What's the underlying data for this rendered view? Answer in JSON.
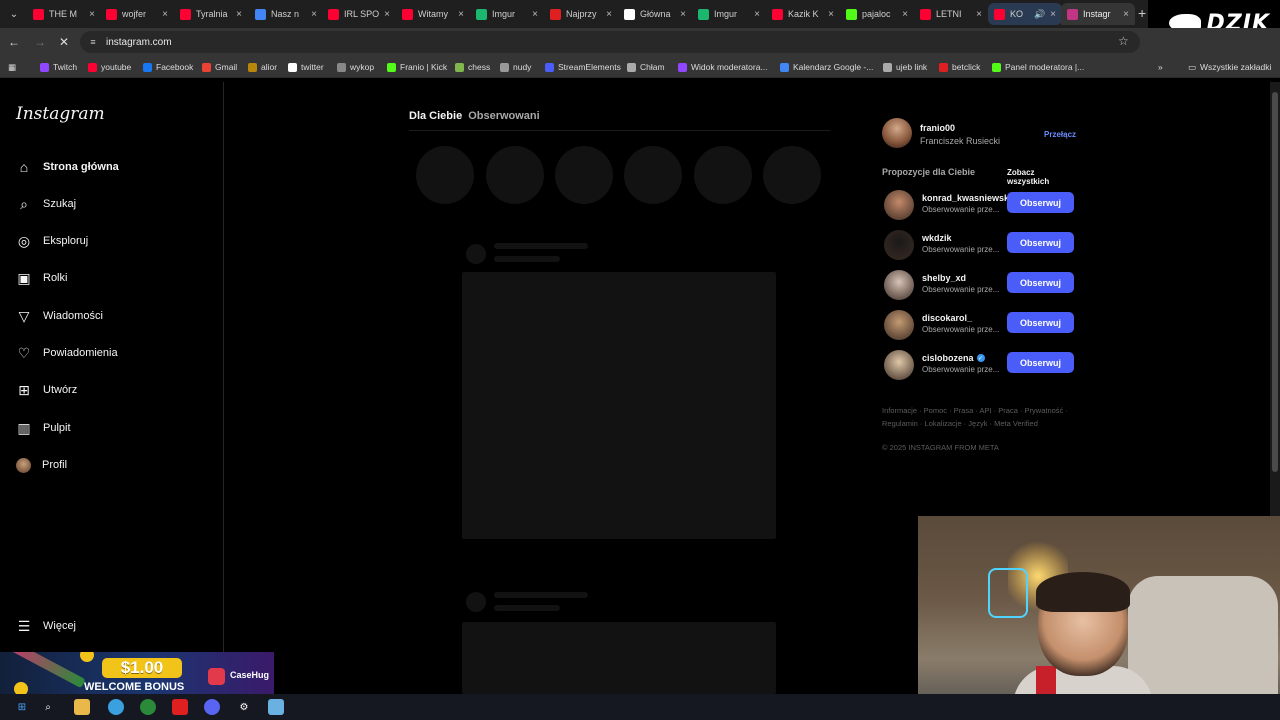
{
  "browser": {
    "tabs": [
      {
        "title": "THE M",
        "favicon_color": "#ff0033",
        "active": false
      },
      {
        "title": "wojfer",
        "favicon_color": "#ff0033",
        "active": false
      },
      {
        "title": "Tyralnia",
        "favicon_color": "#ff0033",
        "active": false
      },
      {
        "title": "Nasz n",
        "favicon_color": "#4285f4",
        "active": false
      },
      {
        "title": "IRL SPO",
        "favicon_color": "#ff0033",
        "active": false
      },
      {
        "title": "Witamy",
        "favicon_color": "#ff0033",
        "active": false
      },
      {
        "title": "Imgur",
        "favicon_color": "#1bb76e",
        "active": false
      },
      {
        "title": "Najprzy",
        "favicon_color": "#e02020",
        "active": false
      },
      {
        "title": "Główna",
        "favicon_color": "#ffffff",
        "active": false
      },
      {
        "title": "Imgur",
        "favicon_color": "#1bb76e",
        "active": false
      },
      {
        "title": "Kazik K",
        "favicon_color": "#ff0033",
        "active": false
      },
      {
        "title": "pajaloc",
        "favicon_color": "#53fc18",
        "active": false
      },
      {
        "title": "LETNI",
        "favicon_color": "#ff0033",
        "active": false
      },
      {
        "title": "KO",
        "favicon_color": "#ff0033",
        "active": false,
        "playing": true
      },
      {
        "title": "Instagr",
        "favicon_color": "#c13584",
        "active": true
      }
    ],
    "new_tab_label": "+",
    "url": "instagram.com",
    "bookmarks": [
      {
        "label": "Twitch",
        "color": "#9146ff"
      },
      {
        "label": "youtube",
        "color": "#ff0033"
      },
      {
        "label": "Facebook",
        "color": "#1877f2"
      },
      {
        "label": "Gmail",
        "color": "#ea4335"
      },
      {
        "label": "alior",
        "color": "#b8860b"
      },
      {
        "label": "twitter",
        "color": "#ffffff"
      },
      {
        "label": "wykop",
        "color": "#888888"
      },
      {
        "label": "Franio | Kick",
        "color": "#53fc18"
      },
      {
        "label": "chess",
        "color": "#81b64c"
      },
      {
        "label": "nudy",
        "color": "#999999"
      },
      {
        "label": "StreamElements",
        "color": "#4a5df9"
      },
      {
        "label": "Chłam",
        "color": "#aaaaaa"
      },
      {
        "label": "Widok moderatora...",
        "color": "#9146ff"
      },
      {
        "label": "Kalendarz Google -...",
        "color": "#4285f4"
      },
      {
        "label": "ujeb link",
        "color": "#aaaaaa"
      },
      {
        "label": "betclick",
        "color": "#e02020"
      },
      {
        "label": "Panel moderatora |...",
        "color": "#53fc18"
      }
    ],
    "more_bookmarks": "»",
    "all_bookmarks": "Wszystkie zakładki"
  },
  "stream_logo": "DZIK",
  "instagram": {
    "logo": "Instagram",
    "nav": [
      {
        "label": "Strona główna",
        "icon": "home-icon",
        "glyph": "⌂"
      },
      {
        "label": "Szukaj",
        "icon": "search-icon",
        "glyph": "⌕"
      },
      {
        "label": "Eksploruj",
        "icon": "compass-icon",
        "glyph": "◎"
      },
      {
        "label": "Rolki",
        "icon": "reels-icon",
        "glyph": "▣"
      },
      {
        "label": "Wiadomości",
        "icon": "messages-icon",
        "glyph": "▽"
      },
      {
        "label": "Powiadomienia",
        "icon": "heart-icon",
        "glyph": "♡"
      },
      {
        "label": "Utwórz",
        "icon": "plus-square-icon",
        "glyph": "⊞"
      },
      {
        "label": "Pulpit",
        "icon": "dashboard-icon",
        "glyph": "▥"
      },
      {
        "label": "Profil",
        "icon": "avatar",
        "glyph": ""
      }
    ],
    "more": "Więcej",
    "feed_tabs": {
      "for_you": "Dla Ciebie",
      "following": "Obserwowani"
    },
    "me": {
      "username": "franio00",
      "full_name": "Franciszek Rusiecki",
      "switch": "Przełącz"
    },
    "suggestions_heading": "Propozycje dla Ciebie",
    "see_all": "Zobacz wszystkich",
    "suggestions": [
      {
        "username": "konrad_kwasniewski",
        "subtitle": "Obserwowanie prze...",
        "button": "Obserwuj",
        "verified": false,
        "avatar_color": "#c48a6a"
      },
      {
        "username": "wkdzik",
        "subtitle": "Obserwowanie prze...",
        "button": "Obserwuj",
        "verified": false,
        "avatar_color": "#1a1a1a"
      },
      {
        "username": "shelby_xd",
        "subtitle": "Obserwowanie prze...",
        "button": "Obserwuj",
        "verified": false,
        "avatar_color": "#d8c4b8"
      },
      {
        "username": "discokarol_",
        "subtitle": "Obserwowanie prze...",
        "button": "Obserwuj",
        "verified": false,
        "avatar_color": "#c49a72"
      },
      {
        "username": "cislobozena",
        "subtitle": "Obserwowanie prze...",
        "button": "Obserwuj",
        "verified": true,
        "avatar_color": "#e0c8a8"
      }
    ],
    "footer_links_line1": "Informacje · Pomoc · Prasa · API · Praca · Prywatność ·",
    "footer_links_line2": "Regulamin · Lokalizacje · Język · Meta Verified",
    "copyright": "© 2025 INSTAGRAM FROM META"
  },
  "ad": {
    "price": "$1.00",
    "text": "WELCOME BONUS",
    "brand": "CaseHug"
  }
}
